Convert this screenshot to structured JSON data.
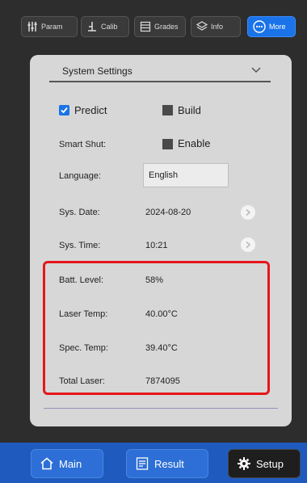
{
  "topbar": {
    "tabs": [
      {
        "label": "Param",
        "icon": "sliders-icon"
      },
      {
        "label": "Calib",
        "icon": "calibration-icon"
      },
      {
        "label": "Grades",
        "icon": "grades-icon"
      },
      {
        "label": "Info",
        "icon": "layers-icon"
      },
      {
        "label": "More",
        "icon": "more-icon",
        "active": true
      }
    ]
  },
  "settings": {
    "section_title": "System Settings",
    "predict": {
      "label": "Predict",
      "checked": true
    },
    "build": {
      "label": "Build",
      "checked": false
    },
    "smart_shut": {
      "label": "Smart Shut:",
      "option_label": "Enable",
      "checked": false
    },
    "language": {
      "label": "Language:",
      "value": "English"
    },
    "sys_date": {
      "label": "Sys. Date:",
      "value": "2024-08-20"
    },
    "sys_time": {
      "label": "Sys. Time:",
      "value": "10:21"
    },
    "batt_level": {
      "label": "Batt. Level:",
      "value": "58%"
    },
    "laser_temp": {
      "label": "Laser Temp:",
      "value": "40.00°C"
    },
    "spec_temp": {
      "label": "Spec. Temp:",
      "value": "39.40°C"
    },
    "total_laser": {
      "label": "Total Laser:",
      "value": "7874095"
    }
  },
  "bottom_nav": {
    "main": "Main",
    "result": "Result",
    "setup": "Setup",
    "active": "Setup"
  },
  "colors": {
    "accent": "#1a73e8",
    "highlight": "#e5161b",
    "bottom_bar": "#1f5bbf"
  }
}
